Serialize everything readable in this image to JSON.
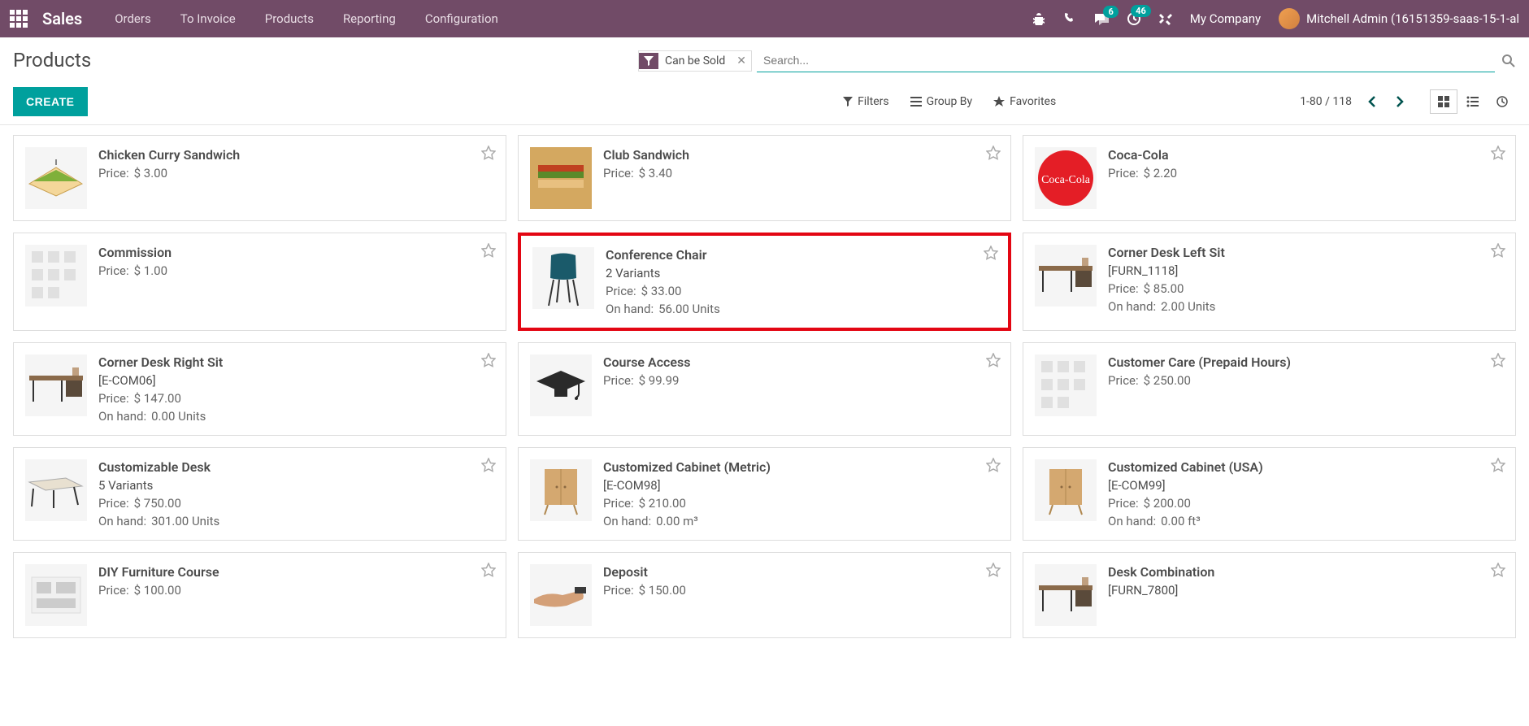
{
  "topbar": {
    "brand": "Sales",
    "menu": [
      "Orders",
      "To Invoice",
      "Products",
      "Reporting",
      "Configuration"
    ],
    "messaging_badge": "6",
    "activity_badge": "46",
    "company": "My Company",
    "user": "Mitchell Admin (16151359-saas-15-1-al"
  },
  "control_panel": {
    "page_title": "Products",
    "filter_chip": "Can be Sold",
    "search_placeholder": "Search...",
    "create_label": "CREATE",
    "filters_label": "Filters",
    "groupby_label": "Group By",
    "favorites_label": "Favorites",
    "pager": "1-80 / 118"
  },
  "labels": {
    "price_prefix": "Price:",
    "onhand_prefix": "On hand:",
    "variants_suffix": "Variants"
  },
  "products": [
    {
      "name": "Chicken Curry Sandwich",
      "price": "$ 3.00",
      "img": "sandwich"
    },
    {
      "name": "Club Sandwich",
      "price": "$ 3.40",
      "img": "club"
    },
    {
      "name": "Coca-Cola",
      "price": "$ 2.20",
      "img": "coke"
    },
    {
      "name": "Commission",
      "price": "$ 1.00",
      "img": "placeholder"
    },
    {
      "name": "Conference Chair",
      "variants": "2",
      "price": "$ 33.00",
      "onhand": "56.00 Units",
      "img": "chair",
      "highlighted": true
    },
    {
      "name": "Corner Desk Left Sit",
      "ref": "[FURN_1118]",
      "price": "$ 85.00",
      "onhand": "2.00 Units",
      "img": "desk"
    },
    {
      "name": "Corner Desk Right Sit",
      "ref": "[E-COM06]",
      "price": "$ 147.00",
      "onhand": "0.00 Units",
      "img": "desk"
    },
    {
      "name": "Course Access",
      "price": "$ 99.99",
      "img": "grad"
    },
    {
      "name": "Customer Care (Prepaid Hours)",
      "price": "$ 250.00",
      "img": "placeholder"
    },
    {
      "name": "Customizable Desk",
      "variants": "5",
      "price": "$ 750.00",
      "onhand": "301.00 Units",
      "img": "table"
    },
    {
      "name": "Customized Cabinet (Metric)",
      "ref": "[E-COM98]",
      "price": "$ 210.00",
      "onhand": "0.00 m³",
      "img": "cabinet"
    },
    {
      "name": "Customized Cabinet (USA)",
      "ref": "[E-COM99]",
      "price": "$ 200.00",
      "onhand": "0.00 ft³",
      "img": "cabinet"
    },
    {
      "name": "DIY Furniture Course",
      "price": "$ 100.00",
      "img": "diy"
    },
    {
      "name": "Deposit",
      "price": "$ 150.00",
      "img": "hand"
    },
    {
      "name": "Desk Combination",
      "ref": "[FURN_7800]",
      "img": "desk"
    }
  ]
}
